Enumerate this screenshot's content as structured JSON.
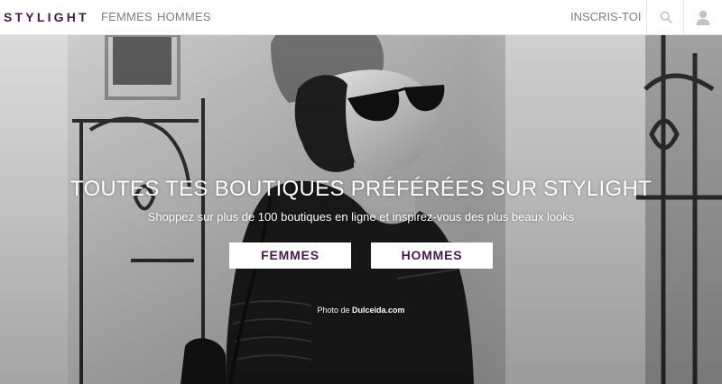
{
  "header": {
    "logo": "STYLIGHT",
    "nav": [
      {
        "label": "FEMMES"
      },
      {
        "label": "HOMMES"
      }
    ],
    "signup_label": "INSCRIS-TOI",
    "search_icon": "search-icon",
    "user_icon": "user-icon"
  },
  "hero": {
    "headline": "TOUTES TES BOUTIQUES PRÉFÉRÉES SUR STYLIGHT",
    "subheadline": "Shoppez sur plus de 100 boutiques en ligne et inspirez-vous des plus beaux looks",
    "buttons": [
      {
        "label": "FEMMES"
      },
      {
        "label": "HOMMES"
      }
    ],
    "credit_prefix": "Photo de ",
    "credit_source": "Dulceida.com"
  },
  "colors": {
    "brand": "#4a1650",
    "nav_text": "#7f7f7f",
    "hero_text": "#ffffff"
  }
}
